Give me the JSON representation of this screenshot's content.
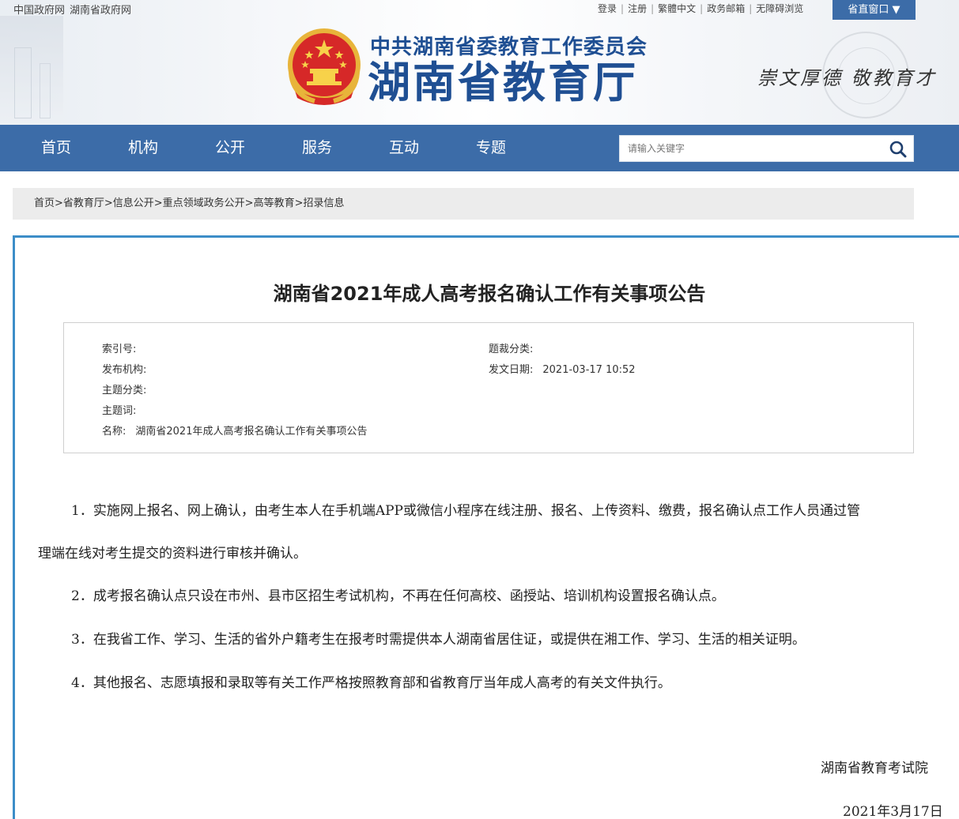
{
  "top_links": {
    "left": [
      "中国政府网",
      "湖南省政府网"
    ],
    "right": [
      "登录",
      "注册",
      "繁體中文",
      "政务邮箱",
      "无障碍浏览"
    ],
    "window_button": "省直窗口 ▼"
  },
  "logo": {
    "line1": "中共湖南省委教育工作委员会",
    "line2": "湖南省教育厅",
    "slogan": "崇文厚德  敬教育才"
  },
  "nav": {
    "items": [
      "首页",
      "机构",
      "公开",
      "服务",
      "互动",
      "专题"
    ],
    "search_placeholder": "请输入关键字"
  },
  "breadcrumb": "首页>省教育厅>信息公开>重点领域政务公开>高等教育>招录信息",
  "article": {
    "title": "湖南省2021年成人高考报名确认工作有关事项公告",
    "meta": {
      "index_label": "索引号:",
      "index_value": "",
      "genre_label": "题裁分类:",
      "genre_value": "",
      "publisher_label": "发布机构:",
      "publisher_value": "",
      "date_label": "发文日期:",
      "date_value": "2021-03-17 10:52",
      "topic_label": "主题分类:",
      "topic_value": "",
      "keywords_label": "主题词:",
      "keywords_value": "",
      "name_label": "名称:",
      "name_value": "湖南省2021年成人高考报名确认工作有关事项公告"
    },
    "paragraphs": {
      "p1_line1": "1．实施网上报名、网上确认，由考生本人在手机端APP或微信小程序在线注册、报名、上传资料、缴费，报名确认点工作人员通过管",
      "p1_line2": "理端在线对考生提交的资料进行审核并确认。",
      "p2": "2．成考报名确认点只设在市州、县市区招生考试机构，不再在任何高校、函授站、培训机构设置报名确认点。",
      "p3": "3．在我省工作、学习、生活的省外户籍考生在报考时需提供本人湖南省居住证，或提供在湘工作、学习、生活的相关证明。",
      "p4": "4．其他报名、志愿填报和录取等有关工作严格按照教育部和省教育厅当年成人高考的有关文件执行。"
    },
    "signer": "湖南省教育考试院",
    "sign_date": "2021年3月17日"
  },
  "colors": {
    "nav_bg": "#3c6ca8",
    "logo_blue": "#1f4f93",
    "frame_border": "#3c8dc8"
  }
}
